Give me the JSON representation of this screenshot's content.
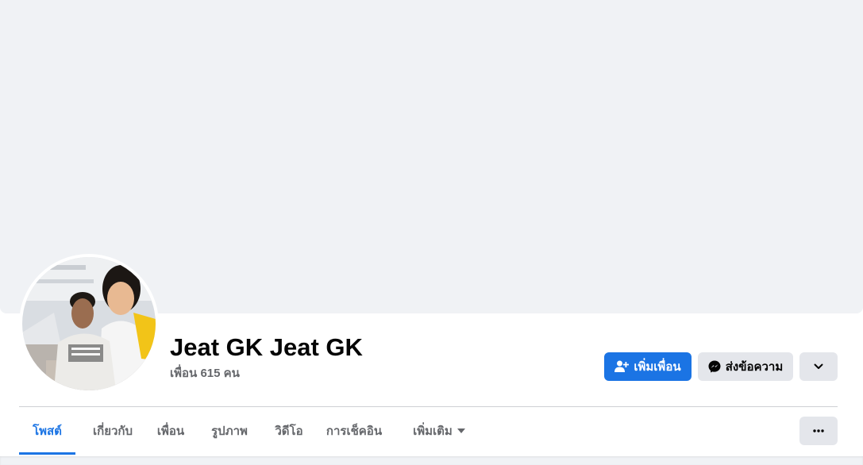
{
  "profile": {
    "name": "Jeat GK Jeat GK",
    "friends_text": "เพื่อน 615 คน"
  },
  "actions": {
    "add_friend": "เพิ่มเพื่อน",
    "message": "ส่งข้อความ"
  },
  "tabs": [
    {
      "label": "โพสต์",
      "active": true
    },
    {
      "label": "เกี่ยวกับ",
      "active": false
    },
    {
      "label": "เพื่อน",
      "active": false
    },
    {
      "label": "รูปภาพ",
      "active": false
    },
    {
      "label": "วิดีโอ",
      "active": false
    },
    {
      "label": "การเช็คอิน",
      "active": false
    },
    {
      "label": "เพิ่มเติม",
      "active": false
    }
  ],
  "icons": {
    "add_friend": "person-plus-icon",
    "message": "messenger-icon",
    "dropdown": "chevron-down-icon",
    "more_tab": "caret-down-icon",
    "options": "ellipsis-icon"
  },
  "colors": {
    "accent": "#1b74e4",
    "cover": "#f0f2f5",
    "secondary_button": "#e4e6eb",
    "muted_text": "#65676b"
  }
}
